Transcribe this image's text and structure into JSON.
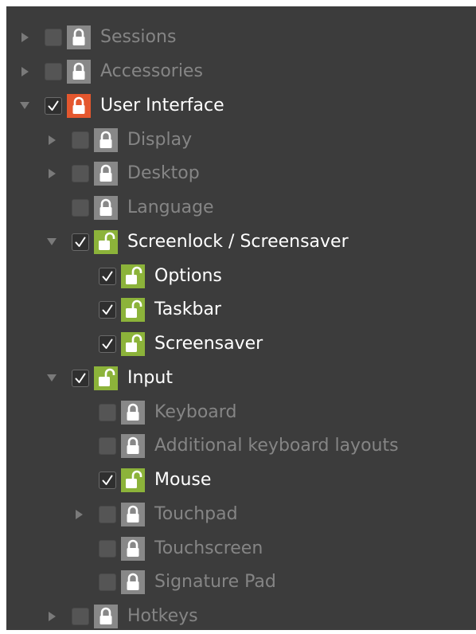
{
  "colors": {
    "background": "#3c3c3c",
    "lock_locked": "#888888",
    "lock_unlocked": "#8cb33a",
    "lock_parent": "#e4572e",
    "text_disabled": "#858585",
    "text_enabled": "#ffffff"
  },
  "tree": {
    "items": [
      {
        "label": "Sessions",
        "level": 0,
        "expander": "collapsed",
        "checked": false,
        "lock": "locked",
        "icon": "lock-icon"
      },
      {
        "label": "Accessories",
        "level": 0,
        "expander": "collapsed",
        "checked": false,
        "lock": "locked",
        "icon": "lock-icon"
      },
      {
        "label": "User Interface",
        "level": 0,
        "expander": "expanded",
        "checked": true,
        "lock": "parent",
        "icon": "lock-icon"
      },
      {
        "label": "Display",
        "level": 1,
        "expander": "collapsed",
        "checked": false,
        "lock": "locked",
        "icon": "lock-icon"
      },
      {
        "label": "Desktop",
        "level": 1,
        "expander": "collapsed",
        "checked": false,
        "lock": "locked",
        "icon": "lock-icon"
      },
      {
        "label": "Language",
        "level": 1,
        "expander": "none",
        "checked": false,
        "lock": "locked",
        "icon": "lock-icon"
      },
      {
        "label": "Screenlock / Screensaver",
        "level": 1,
        "expander": "expanded",
        "checked": true,
        "lock": "unlocked",
        "icon": "unlock-icon"
      },
      {
        "label": "Options",
        "level": 2,
        "expander": "none",
        "checked": true,
        "lock": "unlocked",
        "icon": "unlock-icon"
      },
      {
        "label": "Taskbar",
        "level": 2,
        "expander": "none",
        "checked": true,
        "lock": "unlocked",
        "icon": "unlock-icon"
      },
      {
        "label": "Screensaver",
        "level": 2,
        "expander": "none",
        "checked": true,
        "lock": "unlocked",
        "icon": "unlock-icon"
      },
      {
        "label": "Input",
        "level": 1,
        "expander": "expanded",
        "checked": true,
        "lock": "unlocked",
        "icon": "unlock-icon"
      },
      {
        "label": "Keyboard",
        "level": 2,
        "expander": "none",
        "checked": false,
        "lock": "locked",
        "icon": "lock-icon"
      },
      {
        "label": "Additional keyboard layouts",
        "level": 2,
        "expander": "none",
        "checked": false,
        "lock": "locked",
        "icon": "lock-icon"
      },
      {
        "label": "Mouse",
        "level": 2,
        "expander": "none",
        "checked": true,
        "lock": "unlocked",
        "icon": "unlock-icon"
      },
      {
        "label": "Touchpad",
        "level": 2,
        "expander": "collapsed",
        "checked": false,
        "lock": "locked",
        "icon": "lock-icon"
      },
      {
        "label": "Touchscreen",
        "level": 2,
        "expander": "none",
        "checked": false,
        "lock": "locked",
        "icon": "lock-icon"
      },
      {
        "label": "Signature Pad",
        "level": 2,
        "expander": "none",
        "checked": false,
        "lock": "locked",
        "icon": "lock-icon"
      },
      {
        "label": "Hotkeys",
        "level": 1,
        "expander": "collapsed",
        "checked": false,
        "lock": "locked",
        "icon": "lock-icon"
      }
    ]
  }
}
